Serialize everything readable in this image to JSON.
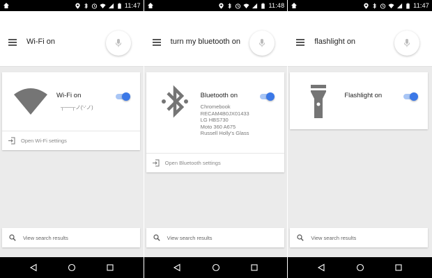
{
  "panels": [
    {
      "status": {
        "time": "11:47"
      },
      "query": "Wi-Fi on",
      "card": {
        "title": "Wi-Fi on",
        "subtitle": "┬──┬ノ('-'ノ)",
        "footer": "Open Wi-Fi settings",
        "toggle_on": true,
        "icon": "wifi-icon"
      },
      "view_results": "View search results"
    },
    {
      "status": {
        "time": "11:48"
      },
      "query": "turn my bluetooth on",
      "card": {
        "title": "Bluetooth on",
        "devices": [
          "Chromebook",
          "RECAM4B0JX01433",
          "LG HBS730",
          "Moto 360 A675",
          "Russell Holly's Glass"
        ],
        "footer": "Open Bluetooth settings",
        "toggle_on": true,
        "icon": "bluetooth-icon"
      },
      "view_results": "View search results"
    },
    {
      "status": {
        "time": "11:47"
      },
      "query": "flashlight on",
      "card": {
        "title": "Flashlight on",
        "toggle_on": true,
        "icon": "flashlight-icon"
      },
      "view_results": "View search results"
    }
  ],
  "colors": {
    "accent": "#3b78e7",
    "background": "#ebebeb",
    "icon_gray": "#757575"
  }
}
